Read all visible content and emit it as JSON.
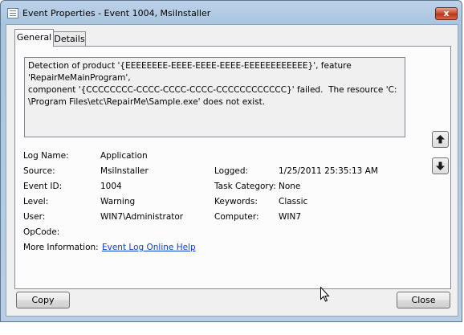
{
  "window": {
    "title": "Event Properties - Event 1004, MsiInstaller",
    "close_glyph": "x"
  },
  "tabs": [
    "General",
    "Details"
  ],
  "description": "Detection of product '{EEEEEEEE-EEEE-EEEE-EEEE-EEEEEEEEEEEE}', feature 'RepairMeMainProgram',\ncomponent '{CCCCCCCC-CCCC-CCCC-CCCC-CCCCCCCCCCCC}' failed.  The resource 'C:\n\\Program Files\\etc\\RepairMe\\Sample.exe' does not exist.",
  "fields": {
    "log_name_label": "Log Name:",
    "log_name": "Application",
    "source_label": "Source:",
    "source": "MsiInstaller",
    "logged_label": "Logged:",
    "logged": "1/25/2011  25:35:13 AM",
    "event_id_label": "Event ID:",
    "event_id": "1004",
    "task_category_label": "Task Category:",
    "task_category": "None",
    "level_label": "Level:",
    "level": "Warning",
    "keywords_label": "Keywords:",
    "keywords": "Classic",
    "user_label": "User:",
    "user": "WIN7\\Administrator",
    "computer_label": "Computer:",
    "computer": "WIN7",
    "opcode_label": "OpCode:",
    "opcode": "",
    "more_info_label": "More Information:",
    "more_info_link": "Event Log Online Help"
  },
  "buttons": {
    "copy": "Copy",
    "close": "Close"
  },
  "icons": [
    "event-viewer-icon",
    "arrow-up-icon",
    "arrow-down-icon",
    "mouse-cursor-icon"
  ]
}
